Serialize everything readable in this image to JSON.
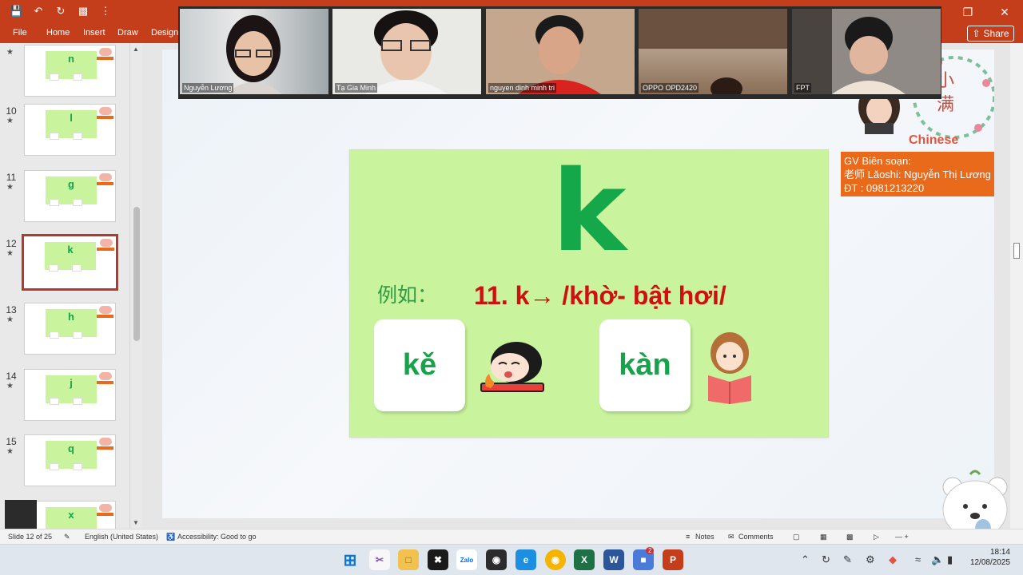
{
  "ribbon": {
    "tabs": [
      "File",
      "Home",
      "Insert",
      "Draw",
      "Design"
    ],
    "share_label": "Share"
  },
  "thumbnails": [
    {
      "num": "",
      "letter": "n",
      "selected": false
    },
    {
      "num": "10",
      "letter": "l",
      "selected": false
    },
    {
      "num": "11",
      "letter": "g",
      "selected": false
    },
    {
      "num": "12",
      "letter": "k",
      "selected": true
    },
    {
      "num": "13",
      "letter": "h",
      "selected": false
    },
    {
      "num": "14",
      "letter": "j",
      "selected": false
    },
    {
      "num": "15",
      "letter": "q",
      "selected": false
    },
    {
      "num": "",
      "letter": "x",
      "selected": false
    }
  ],
  "slide": {
    "big_letter": "k",
    "vidu": "例如：",
    "rule": "11. k→ /khờ- bật hơi/",
    "word1": "kě",
    "word2": "kàn"
  },
  "branding": {
    "logo_chars": "小满",
    "logo_text": "Chinese",
    "author_line1": "GV Biên soạn:",
    "author_line2": "老师 Lǎoshi: Nguyễn Thị Lương",
    "author_line3": "ĐT : 0981213220"
  },
  "video": {
    "participants": [
      "Nguyễn Lương",
      "Tạ Gia Minh",
      "nguyen dinh minh tri",
      "OPPO OPD2420",
      "FPT"
    ]
  },
  "status": {
    "slide_info": "Slide 12 of 25",
    "language": "English (United States)",
    "accessibility": "Accessibility: Good to go",
    "notes": "Notes",
    "comments": "Comments"
  },
  "taskbar": {
    "time": "18:14",
    "date": "12/08/2025",
    "zalo_label": "Zalo",
    "excel_label": "X",
    "word_label": "W",
    "ppt_label": "P",
    "badge_count": "2"
  },
  "colors": {
    "accent": "#c43e1c",
    "slide_green": "#c9f39c",
    "letter_green": "#15a84a",
    "rule_red": "#d01010",
    "author_orange": "#ea6a1b"
  }
}
